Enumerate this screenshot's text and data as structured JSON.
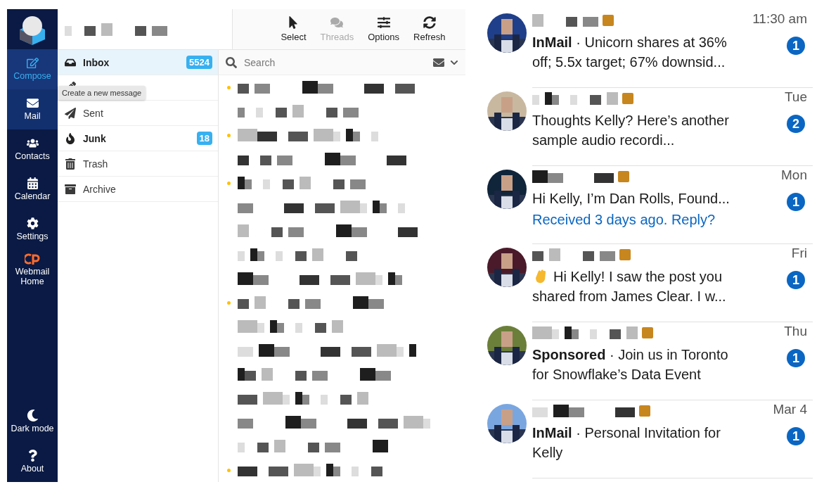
{
  "webmail": {
    "nav": [
      {
        "kind": "compose",
        "label": "Compose",
        "selected": false,
        "hovered": true
      },
      {
        "kind": "mail",
        "label": "Mail",
        "selected": true,
        "hovered": false
      },
      {
        "kind": "contacts",
        "label": "Contacts",
        "selected": false,
        "hovered": false
      },
      {
        "kind": "calendar",
        "label": "Calendar",
        "selected": false,
        "hovered": false
      },
      {
        "kind": "settings",
        "label": "Settings",
        "selected": false,
        "hovered": false
      },
      {
        "kind": "home",
        "label": "Webmail Home",
        "selected": false,
        "hovered": false
      }
    ],
    "nav_bottom": [
      {
        "kind": "moon",
        "label": "Dark mode"
      },
      {
        "kind": "help",
        "label": "About"
      }
    ],
    "tooltip": "Create a new message",
    "folders": [
      {
        "kind": "inbox",
        "label": "Inbox",
        "count": "5524",
        "selected": true,
        "unread": true
      },
      {
        "kind": "drafts",
        "selected": false
      },
      {
        "kind": "sent",
        "label": "Sent",
        "selected": false,
        "unread": false
      },
      {
        "kind": "junk",
        "label": "Junk",
        "count": "18",
        "selected": false,
        "unread": true
      },
      {
        "kind": "trash",
        "label": "Trash",
        "selected": false,
        "unread": false
      },
      {
        "kind": "archive",
        "label": "Archive",
        "selected": false,
        "unread": false
      }
    ],
    "toolbar": [
      {
        "kind": "select",
        "label": "Select",
        "disabled": false
      },
      {
        "kind": "threads",
        "label": "Threads",
        "disabled": true
      },
      {
        "kind": "options",
        "label": "Options",
        "disabled": false
      },
      {
        "kind": "refresh",
        "label": "Refresh",
        "disabled": false
      }
    ],
    "search": {
      "placeholder": "Search"
    },
    "messages": [
      {
        "unread": true
      },
      {
        "unread": false
      },
      {
        "unread": true
      },
      {
        "unread": false
      },
      {
        "unread": true
      },
      {
        "unread": false
      },
      {
        "unread": false
      },
      {
        "unread": false
      },
      {
        "unread": false
      },
      {
        "unread": true
      },
      {
        "unread": false
      },
      {
        "unread": false
      },
      {
        "unread": false
      },
      {
        "unread": false
      },
      {
        "unread": false
      },
      {
        "unread": false
      },
      {
        "unread": true
      }
    ]
  },
  "conversations": [
    {
      "time": "11:30 am",
      "preview": "**InMail** · Unicorn shares at 36% off; 5.5x target; 67% downsid...",
      "unread_count": "1",
      "wave": false
    },
    {
      "time": "Tue",
      "preview": "Thoughts Kelly?  Here’s another sample audio recordi...",
      "unread_count": "2",
      "wave": false
    },
    {
      "time": "Mon",
      "preview": "Hi Kelly, I’m Dan Rolls, Found...",
      "reply_prompt": "Received 3 days ago. Reply?",
      "unread_count": "1",
      "wave": false
    },
    {
      "time": "Fri",
      "preview": "Hi Kelly! I saw the post you shared from James Clear. I w...",
      "unread_count": "1",
      "wave": true
    },
    {
      "time": "Thu",
      "preview": "**Sponsored** · Join us in Toronto for Snowflake’s Data Event",
      "unread_count": "1",
      "wave": false
    },
    {
      "time": "Mar 4",
      "preview": "**InMail** · Personal Invitation for Kelly",
      "unread_count": "1",
      "wave": false
    }
  ]
}
